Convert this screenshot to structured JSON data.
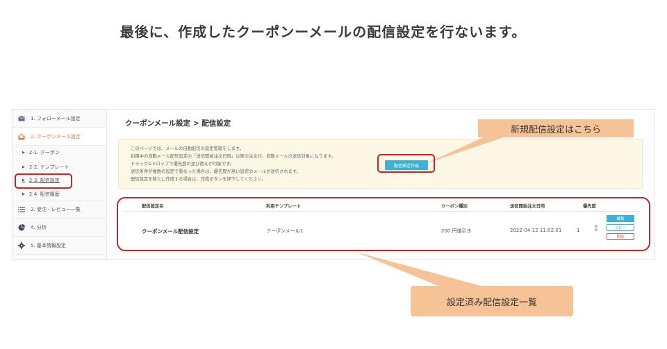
{
  "slide": {
    "title": "最後に、作成したクーポンーメールの配信設定を行ないます。",
    "callout_new": "新規配信設定はこちら",
    "callout_list": "設定済み配信設定一覧"
  },
  "sidebar": {
    "items": [
      {
        "label": "1. フォローメール設定",
        "icon": "mail-icon"
      },
      {
        "label": "2. クーポンメール設定",
        "icon": "coupon-mail-icon",
        "active": true
      },
      {
        "label": "3. 受注・レビュー一覧",
        "icon": "list-icon"
      },
      {
        "label": "4. 分析",
        "icon": "pie-chart-icon"
      },
      {
        "label": "5. 基本情報設定",
        "icon": "gear-icon"
      }
    ],
    "subitems": [
      {
        "label": "2-1. クーポン"
      },
      {
        "label": "2-2. テンプレート"
      },
      {
        "label": "2-3. 配信設定",
        "current": true
      },
      {
        "label": "2-4. 配信履歴"
      }
    ]
  },
  "main": {
    "heading": "クーポンメール設定 > 配信設定",
    "info_lines": [
      "このページでは、メールの自動配信の設定管理をします。",
      "利用中の自動メール配信設定の「送信開始注文日時」以降の注文が、自動メールの送信対象になります。",
      "ドラッグ&ドロップで優先度の並び替えが可能です。",
      "送信条件が複数の設定で重なった場合は、優先度が高い設定のメールが送信されます。",
      "配信設定を新たに作成する場合は、作成ボタンを押下してください。"
    ],
    "create_button": "配信設定作成",
    "table": {
      "headers": [
        "配信設定名",
        "利用テンプレート",
        "クーポン種別",
        "送信開始注文日時",
        "優先度"
      ],
      "row": {
        "name": "クーポンメール配信設定",
        "template": "クーポンメール1",
        "coupon_type": "200 円値引き",
        "start_datetime": "2022-04-12 11:02:01",
        "priority": "1"
      },
      "actions": {
        "edit": "編集",
        "copy": "コピー",
        "delete": "削除"
      }
    }
  },
  "colors": {
    "highlight": "#d0201f",
    "callout": "#f6c397",
    "accent": "#38b3d6",
    "active": "#e07b3c"
  }
}
